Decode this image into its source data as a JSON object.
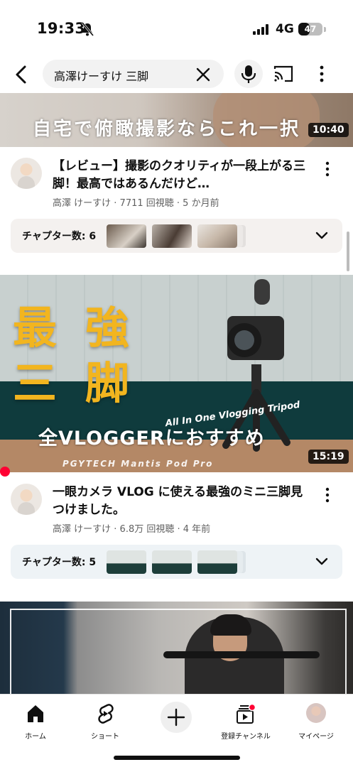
{
  "status_bar": {
    "time": "19:33",
    "network": "4G",
    "battery": "47",
    "battery_level_percent": 47
  },
  "search": {
    "query": "高澤けーすけ 三脚",
    "icons": [
      "back-arrow-icon",
      "clear-icon",
      "mic-icon",
      "cast-icon",
      "more-vert-icon"
    ]
  },
  "videos": [
    {
      "thumbnail_text": "自宅で俯瞰撮影ならこれ一択",
      "duration": "10:40",
      "title": "【レビュー】撮影のクオリティが一段上がる三脚！最高ではあるんだけど…",
      "channel": "高澤 けーすけ",
      "views": "7711 回視聴",
      "age": "5 か月前",
      "chapters_label": "チャプター数: 6"
    },
    {
      "thumbnail_text_big": [
        "最",
        "強",
        "三",
        "脚"
      ],
      "thumbnail_script": "All In One Vlogging Tripod",
      "thumbnail_headline": "全VLOGGERにおすすめ",
      "thumbnail_brand": "PGYTECH Mantis Pod Pro",
      "duration": "15:19",
      "title": "一眼カメラ VLOG に使える最強のミニ三脚見つけました。",
      "channel": "高澤 けーすけ",
      "views": "6.8万 回視聴",
      "age": "4 年前",
      "chapters_label": "チャプター数: 5"
    }
  ],
  "bottom_nav": [
    {
      "label": "ホーム",
      "icon": "home-icon"
    },
    {
      "label": "ショート",
      "icon": "shorts-icon"
    },
    {
      "label": "",
      "icon": "create-icon"
    },
    {
      "label": "登録チャンネル",
      "icon": "subscriptions-icon"
    },
    {
      "label": "マイページ",
      "icon": "avatar-icon"
    }
  ],
  "colors": {
    "accent_red": "#ff0033",
    "thumbnail_yellow": "#f2b51f",
    "chip_bg_1": "#f4f1ef",
    "chip_bg_2": "#eef3f6"
  }
}
